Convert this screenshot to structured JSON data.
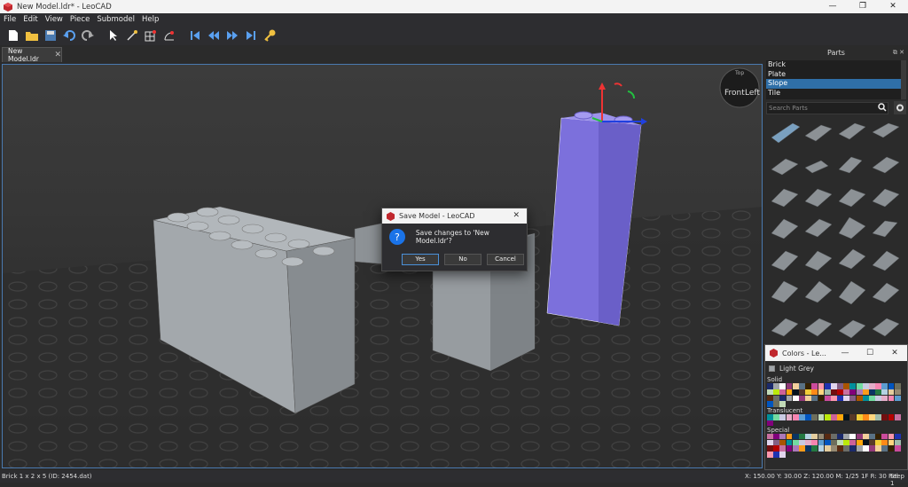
{
  "window": {
    "title": "New Model.ldr* - LeoCAD",
    "min": "—",
    "restore": "❐",
    "close": "✕"
  },
  "menu": [
    "File",
    "Edit",
    "View",
    "Piece",
    "Submodel",
    "Help"
  ],
  "tab": {
    "label": "New Model.ldr",
    "close": "✕"
  },
  "viewcube": {
    "front": "Front",
    "left": "Left",
    "top": "Top"
  },
  "parts_panel": {
    "title": "Parts",
    "categories": [
      "Brick",
      "Plate",
      "Slope",
      "Tile"
    ],
    "selected_category": "Slope",
    "search_placeholder": "Search Parts"
  },
  "colors_panel": {
    "title": "Colors - Le...",
    "current": "Light Grey",
    "sections": [
      "Solid",
      "Translucent",
      "Special"
    ]
  },
  "dialog": {
    "title": "Save Model - LeoCAD",
    "message": "Save changes to 'New Model.ldr'?",
    "yes": "Yes",
    "no": "No",
    "cancel": "Cancel"
  },
  "status": {
    "left": "Brick 1 x 2 x 5 (ID: 2454.dat)",
    "coords": "X: 150.00 Y: 30.00 Z: 120.00    M: 1/25 1F R: 30 Rel",
    "step": "Step 1"
  },
  "colors": {
    "accent": "#2f6fa8",
    "selection": "#7b6fd9",
    "brick": "#a0a5a9"
  }
}
